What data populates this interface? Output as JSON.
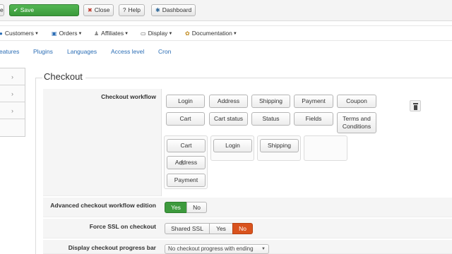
{
  "toolbar": {
    "save": "Save",
    "close": "Close",
    "help": "Help",
    "dashboard": "Dashboard",
    "icons": {
      "save": "check-icon",
      "close": "close-icon",
      "help": "question-icon",
      "dashboard": "dashboard-icon"
    },
    "save_color": "#45a845"
  },
  "menu": {
    "items": [
      {
        "label": "Customers",
        "icon": "users-icon"
      },
      {
        "label": "Orders",
        "icon": "orders-icon"
      },
      {
        "label": "Affiliates",
        "icon": "affiliates-icon"
      },
      {
        "label": "Display",
        "icon": "display-icon"
      },
      {
        "label": "Documentation",
        "icon": "gears-icon"
      }
    ]
  },
  "subnav": {
    "links": [
      "eatures",
      "Plugins",
      "Languages",
      "Access level",
      "Cron"
    ],
    "link_color": "#2a6db5"
  },
  "fieldset": {
    "legend": "Checkout"
  },
  "rows": {
    "checkout_workflow": {
      "label": "Checkout workflow"
    },
    "advanced_edition": {
      "label": "Advanced checkout workflow edition",
      "options": [
        "Yes",
        "No"
      ],
      "selected": "Yes"
    },
    "force_ssl": {
      "label": "Force SSL on checkout",
      "options": [
        "Shared SSL",
        "Yes",
        "No"
      ],
      "selected": "No"
    },
    "progress_bar": {
      "label": "Display checkout progress bar",
      "value": "No checkout progress with ending"
    }
  },
  "workflow": {
    "available_row1": [
      "Login",
      "Address",
      "Shipping",
      "Payment",
      "Coupon"
    ],
    "available_row2": [
      "Cart",
      "Cart status",
      "Status",
      "Fields",
      "Terms and Conditions"
    ],
    "step1": [
      "Cart",
      "Address",
      "Payment"
    ],
    "step2": [
      "Login"
    ],
    "step3": [
      "Shipping"
    ],
    "step4": []
  },
  "colors": {
    "yes_active": "#3d9a3d",
    "no_active": "#d9531e"
  }
}
